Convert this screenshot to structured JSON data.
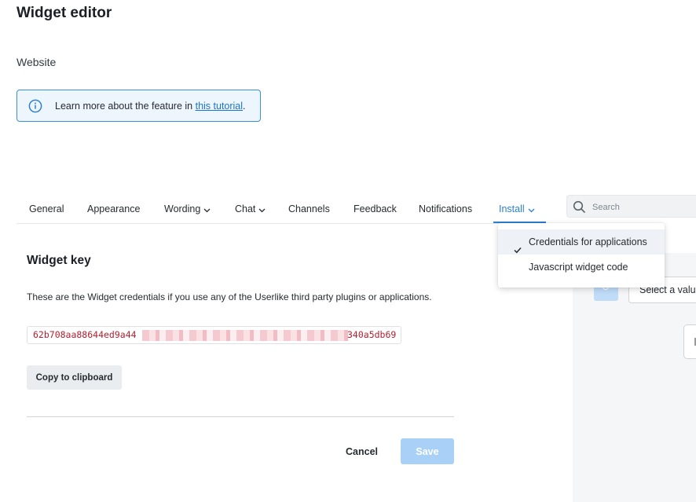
{
  "page": {
    "title": "Widget editor",
    "subtitle": "Website"
  },
  "info": {
    "text": "Learn more about the feature in ",
    "link": "this tutorial",
    "suffix": "."
  },
  "tabs": [
    {
      "label": "General",
      "has_dropdown": false
    },
    {
      "label": "Appearance",
      "has_dropdown": false
    },
    {
      "label": "Wording",
      "has_dropdown": true
    },
    {
      "label": "Chat",
      "has_dropdown": true
    },
    {
      "label": "Channels",
      "has_dropdown": false
    },
    {
      "label": "Feedback",
      "has_dropdown": false
    },
    {
      "label": "Notifications",
      "has_dropdown": false
    },
    {
      "label": "Install",
      "has_dropdown": true,
      "active": true
    }
  ],
  "search": {
    "placeholder": "Search"
  },
  "install_menu": {
    "items": [
      {
        "label": "Credentials for applications",
        "selected": true
      },
      {
        "label": "Javascript widget code",
        "selected": false
      }
    ]
  },
  "widget_key": {
    "title": "Widget key",
    "description": "These are the Widget credentials if you use any of the Userlike third party plugins or applications.",
    "key_visible_start": "62b708aa88644ed9a44",
    "key_visible_end": "340a5db69",
    "key_redacted": true,
    "copy_label": "Copy to clipboard"
  },
  "footer": {
    "cancel_label": "Cancel",
    "save_label": "Save"
  },
  "right_panel": {
    "select_placeholder": "Select a value"
  },
  "colors": {
    "accent": "#2b7fd4",
    "save_disabled": "#a9d1f7",
    "info_border": "#3b8fd9",
    "info_bg": "#eef6fd",
    "key_text": "#b4202f"
  },
  "icons": {
    "info": "info-circle-icon",
    "search": "search-icon",
    "chevron": "chevron-down-icon",
    "check": "check-icon"
  }
}
